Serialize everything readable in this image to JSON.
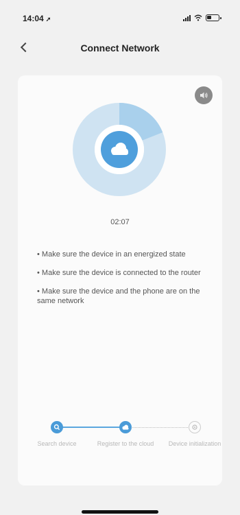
{
  "status_bar": {
    "time": "14:04",
    "location_icon": "location-arrow-icon",
    "icons": [
      "signal-icon",
      "wifi-icon",
      "battery-icon"
    ]
  },
  "nav": {
    "back_icon": "chevron-left-icon",
    "title": "Connect Network"
  },
  "card": {
    "sound_icon": "speaker-icon",
    "progress": {
      "center_icon": "cloud-icon",
      "track_color": "#cfe3f2",
      "progress_color": "#a9d0ec",
      "center_color": "#4f9fdc",
      "progress_fraction": 0.19
    },
    "countdown": "02:07",
    "tips": [
      "• Make sure the device in an energized state",
      "• Make sure the device is connected to the router",
      "• Make sure the device and the phone are on the same network"
    ],
    "steps": [
      {
        "label": "Search device",
        "state": "done",
        "icon": "search-icon"
      },
      {
        "label": "Register to the cloud",
        "state": "active",
        "icon": "cloud-icon"
      },
      {
        "label": "Device initialization",
        "state": "pending",
        "icon": "gear-icon"
      }
    ]
  }
}
